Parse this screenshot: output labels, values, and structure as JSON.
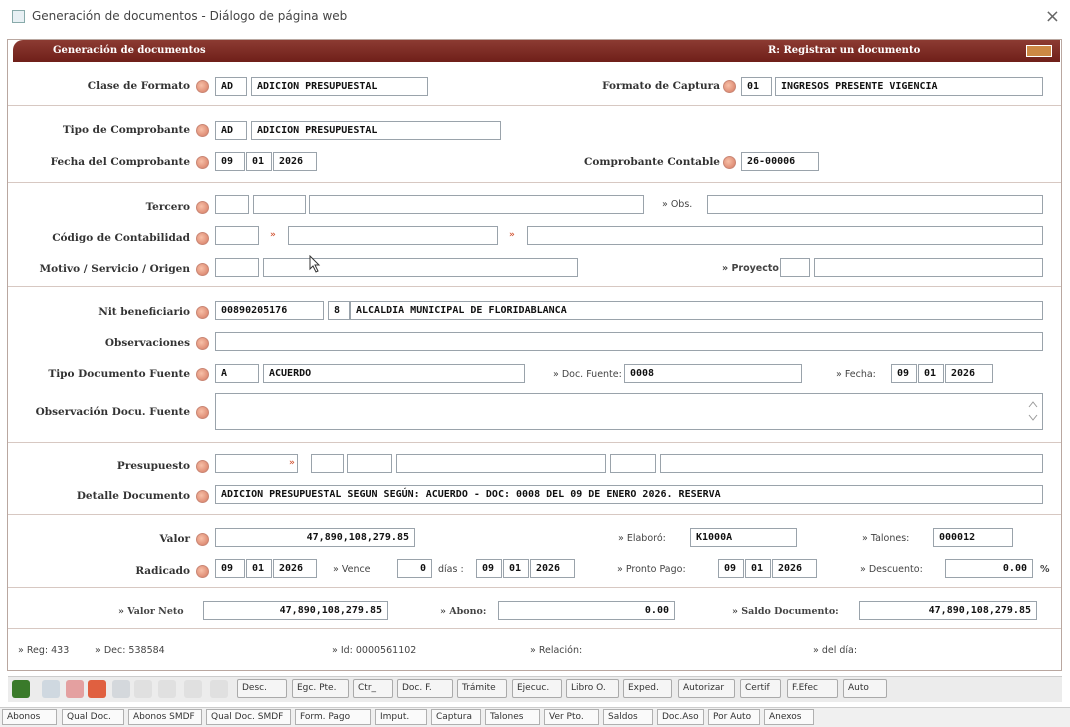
{
  "window": {
    "title": "Generación de documentos - Diálogo de página web",
    "close": "×"
  },
  "header": {
    "left": "Generación de documentos",
    "right": "R: Registrar un documento"
  },
  "form": {
    "clase_formato": {
      "label": "Clase de Formato",
      "code": "AD",
      "desc": "ADICION PRESUPUESTAL"
    },
    "formato_captura": {
      "label": "Formato de Captura",
      "code": "01",
      "desc": "INGRESOS PRESENTE VIGENCIA"
    },
    "tipo_comprobante": {
      "label": "Tipo de Comprobante",
      "code": "AD",
      "desc": "ADICION PRESUPUESTAL"
    },
    "fecha_comprobante": {
      "label": "Fecha del Comprobante",
      "d": "09",
      "m": "01",
      "y": "2026"
    },
    "comprobante_contable": {
      "label": "Comprobante Contable",
      "value": "26-00006"
    },
    "tercero": {
      "label": "Tercero",
      "obs_label": "» Obs."
    },
    "codigo_contabilidad": {
      "label": "Código de Contabilidad"
    },
    "motivo": {
      "label": "Motivo / Servicio / Origen",
      "proyecto_label": "» Proyecto"
    },
    "nit": {
      "label": "Nit beneficiario",
      "value": "00890205176",
      "dv": "8",
      "name": "ALCALDIA MUNICIPAL DE FLORIDABLANCA"
    },
    "observaciones": {
      "label": "Observaciones"
    },
    "tipo_doc_fuente": {
      "label": "Tipo Documento Fuente",
      "code": "A",
      "desc": "ACUERDO",
      "doc_label": "» Doc. Fuente:",
      "doc_value": "0008",
      "fecha_label": "» Fecha:",
      "d": "09",
      "m": "01",
      "y": "2026"
    },
    "obs_doc_fuente": {
      "label": "Observación Docu. Fuente"
    },
    "presupuesto": {
      "label": "Presupuesto"
    },
    "detalle": {
      "label": "Detalle Documento",
      "value": "ADICION PRESUPUESTAL SEGUN SEGÚN: ACUERDO - DOC: 0008 DEL 09 DE ENERO 2026. RESERVA"
    },
    "valor": {
      "label": "Valor",
      "value": "47,890,108,279.85",
      "elaboro_label": "» Elaboró:",
      "elaboro": "K1000A",
      "talones_label": "» Talones:",
      "talones": "000012"
    },
    "radicado": {
      "label": "Radicado",
      "d": "09",
      "m": "01",
      "y": "2026",
      "vence_label": "» Vence",
      "vence": "0",
      "dias_label": "días :",
      "vd": "09",
      "vm": "01",
      "vy": "2026",
      "pronto_label": "» Pronto Pago:",
      "pd": "09",
      "pm": "01",
      "py": "2026",
      "descuento_label": "» Descuento:",
      "descuento": "0.00",
      "pct": "%"
    },
    "neto": {
      "label": "» Valor Neto",
      "value": "47,890,108,279.85",
      "abono_label": "» Abono:",
      "abono": "0.00",
      "saldo_label": "» Saldo Documento:",
      "saldo": "47,890,108,279.85"
    },
    "footer": {
      "reg": "» Reg: 433",
      "dec": "» Dec: 538584",
      "id": "» Id: 0000561102",
      "relacion": "» Relación:",
      "deldia": "» del día:"
    }
  },
  "toolbar": [
    "Desc.",
    "Egc. Pte.",
    "Ctr_",
    "Doc. F.",
    "Trámite",
    "Ejecuc.",
    "Libro O.",
    "Exped.",
    "Autorizar",
    "Certif",
    "F.Efec",
    "Auto"
  ],
  "bottombar": [
    "Abonos",
    "Qual Doc.",
    "Abonos SMDF",
    "Qual Doc. SMDF",
    "Form. Pago",
    "Imput.",
    "Captura",
    "Talones",
    "Ver Pto.",
    "Saldos",
    "Doc.Aso",
    "Por Auto",
    "Anexos"
  ]
}
